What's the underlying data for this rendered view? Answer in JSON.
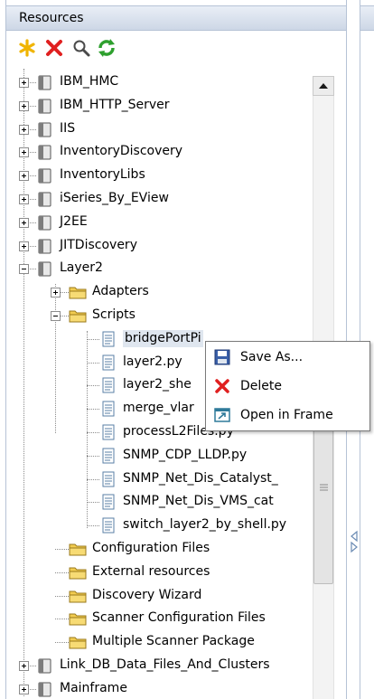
{
  "panel": {
    "title": "Resources"
  },
  "toolbar": {
    "new_label": "New",
    "delete_label": "Delete",
    "search_label": "Search",
    "refresh_label": "Refresh"
  },
  "tree": {
    "items": [
      {
        "label": "IBM_HMC",
        "type": "package",
        "level": 0,
        "expander": "plus"
      },
      {
        "label": "IBM_HTTP_Server",
        "type": "package",
        "level": 0,
        "expander": "plus"
      },
      {
        "label": "IIS",
        "type": "package",
        "level": 0,
        "expander": "plus"
      },
      {
        "label": "InventoryDiscovery",
        "type": "package",
        "level": 0,
        "expander": "plus"
      },
      {
        "label": "InventoryLibs",
        "type": "package",
        "level": 0,
        "expander": "plus"
      },
      {
        "label": "iSeries_By_EView",
        "type": "package",
        "level": 0,
        "expander": "plus"
      },
      {
        "label": "J2EE",
        "type": "package",
        "level": 0,
        "expander": "plus"
      },
      {
        "label": "JITDiscovery",
        "type": "package",
        "level": 0,
        "expander": "plus"
      },
      {
        "label": "Layer2",
        "type": "package",
        "level": 0,
        "expander": "minus"
      },
      {
        "label": "Adapters",
        "type": "folder",
        "level": 1,
        "expander": "plus"
      },
      {
        "label": "Scripts",
        "type": "folder",
        "level": 1,
        "expander": "minus"
      },
      {
        "label": "bridgePortPi",
        "type": "script",
        "level": 2,
        "selected": true
      },
      {
        "label": "layer2.py",
        "type": "script",
        "level": 2
      },
      {
        "label": "layer2_she",
        "type": "script",
        "level": 2
      },
      {
        "label": "merge_vlar",
        "type": "script",
        "level": 2
      },
      {
        "label": "processL2Files.py",
        "type": "script",
        "level": 2
      },
      {
        "label": "SNMP_CDP_LLDP.py",
        "type": "script",
        "level": 2
      },
      {
        "label": "SNMP_Net_Dis_Catalyst_",
        "type": "script",
        "level": 2
      },
      {
        "label": "SNMP_Net_Dis_VMS_cat",
        "type": "script",
        "level": 2
      },
      {
        "label": "switch_layer2_by_shell.py",
        "type": "script",
        "level": 2
      },
      {
        "label": "Configuration Files",
        "type": "folder",
        "level": 1
      },
      {
        "label": "External resources",
        "type": "folder",
        "level": 1
      },
      {
        "label": "Discovery Wizard",
        "type": "folder",
        "level": 1
      },
      {
        "label": "Scanner Configuration Files",
        "type": "folder",
        "level": 1
      },
      {
        "label": "Multiple Scanner Package",
        "type": "folder",
        "level": 1
      },
      {
        "label": "Link_DB_Data_Files_And_Clusters",
        "type": "package",
        "level": 0,
        "expander": "plus"
      },
      {
        "label": "Mainframe",
        "type": "package",
        "level": 0,
        "expander": "plus"
      }
    ]
  },
  "context_menu": {
    "items": [
      {
        "label": "Save As...",
        "icon": "save-icon"
      },
      {
        "label": "Delete",
        "icon": "delete-x-icon"
      },
      {
        "label": "Open in Frame",
        "icon": "open-frame-icon"
      }
    ]
  },
  "colors": {
    "header_border": "#b6c3d6",
    "delete_red": "#e02020",
    "new_yellow": "#f0b400",
    "refresh_green": "#2ea02e",
    "folder_yellow": "#f2cc50",
    "selection": "#dfe6ef"
  }
}
